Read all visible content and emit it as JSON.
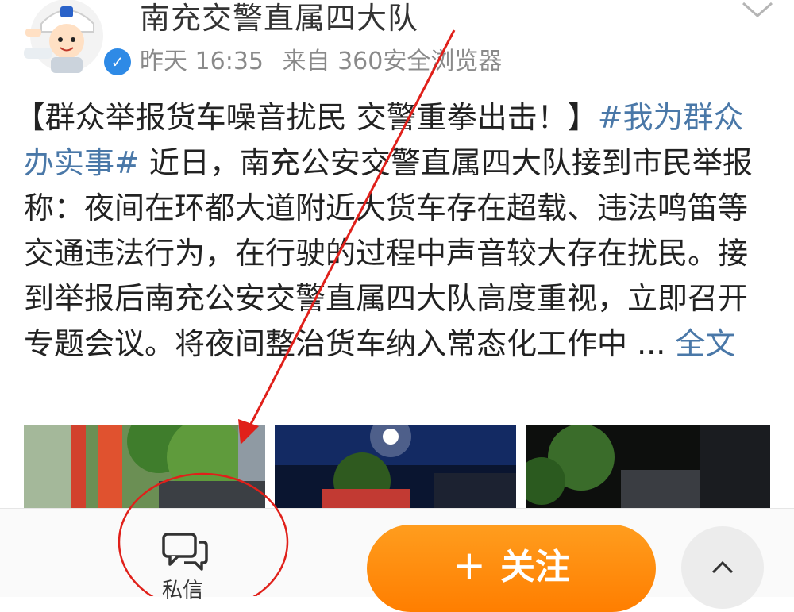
{
  "header": {
    "account_name": "南充交警直属四大队",
    "time": "昨天 16:35",
    "source": "来自 360安全浏览器"
  },
  "post": {
    "title_bracketed": "【群众举报货车噪音扰民 交警重拳出击！】",
    "hashtag": "#我为群众办实事#",
    "body": " 近日，南充公安交警直属四大队接到市民举报称：夜间在环都大道附近大货车存在超载、违法鸣笛等交通违法行为，在行驶的过程中声音较大存在扰民。接到举报后南充公安交警直属四大队高度重视，立即召开专题会议。将夜间整治货车纳入常态化工作中 ...",
    "full_text_link": " 全文"
  },
  "images": [
    {
      "alt": "photo-street-banners"
    },
    {
      "alt": "photo-night-lamp"
    },
    {
      "alt": "photo-night-trees"
    }
  ],
  "bottom_bar": {
    "dm_label": "私信",
    "follow_plus": "+",
    "follow_label": "关注"
  },
  "icons": {
    "dm": "chat-bubbles-icon",
    "up": "chevron-up-icon",
    "more": "chevron-down-icon",
    "verified": "verified-badge-icon"
  },
  "colors": {
    "link": "#4a78a8",
    "follow_orange": "#ff8a00",
    "annotation_red": "#e0201a",
    "verified_blue": "#2e8ae6"
  }
}
